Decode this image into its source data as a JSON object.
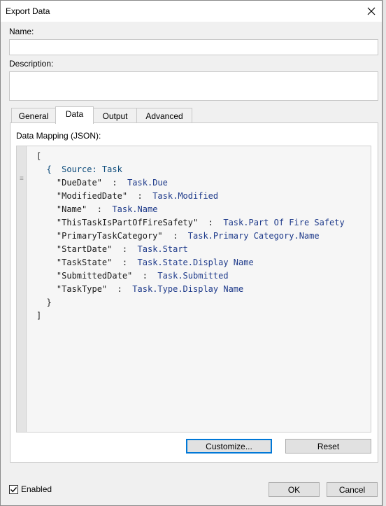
{
  "window": {
    "title": "Export Data"
  },
  "form": {
    "name_label": "Name:",
    "name_value": "",
    "description_label": "Description:",
    "description_value": ""
  },
  "tabs": [
    {
      "label": "General",
      "active": false
    },
    {
      "label": "Data",
      "active": true
    },
    {
      "label": "Output",
      "active": false
    },
    {
      "label": "Advanced",
      "active": false
    }
  ],
  "data_tab": {
    "mapping_label": "Data Mapping (JSON):",
    "json": {
      "open_bracket": "[",
      "source_line": "{  Source: Task",
      "source_key": "Source:",
      "source_value": "Task",
      "mappings": [
        {
          "key": "\"DueDate\"",
          "value": "Task.Due"
        },
        {
          "key": "\"ModifiedDate\"",
          "value": "Task.Modified"
        },
        {
          "key": "\"Name\"",
          "value": "Task.Name"
        },
        {
          "key": "\"ThisTaskIsPartOfFireSafety\"",
          "value": "Task.Part Of Fire Safety"
        },
        {
          "key": "\"PrimaryTaskCategory\"",
          "value": "Task.Primary Category.Name"
        },
        {
          "key": "\"StartDate\"",
          "value": "Task.Start"
        },
        {
          "key": "\"TaskState\"",
          "value": "Task.State.Display Name"
        },
        {
          "key": "\"SubmittedDate\"",
          "value": "Task.Submitted"
        },
        {
          "key": "\"TaskType\"",
          "value": "Task.Type.Display Name"
        }
      ],
      "close_brace": "}",
      "close_bracket": "]",
      "separator": ":"
    },
    "customize_label": "Customize...",
    "reset_label": "Reset"
  },
  "footer": {
    "enabled_label": "Enabled",
    "enabled_checked": true,
    "ok_label": "OK",
    "cancel_label": "Cancel"
  }
}
